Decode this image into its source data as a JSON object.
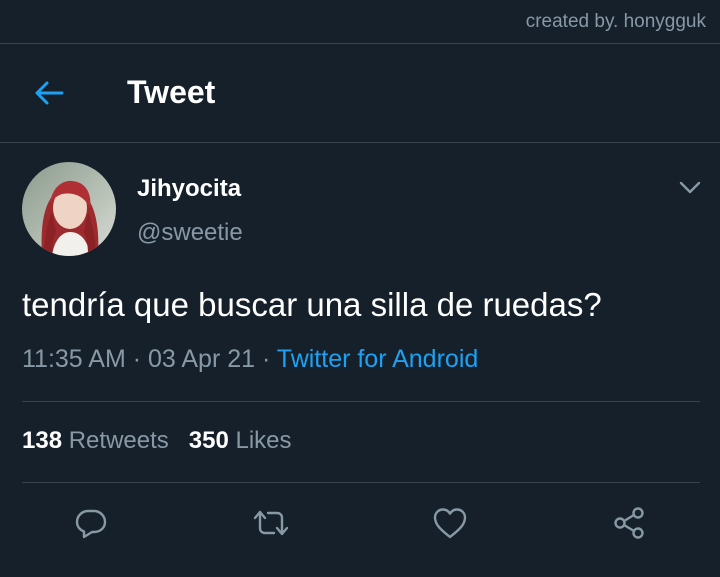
{
  "credit": "created by. honygguk",
  "header": {
    "title": "Tweet"
  },
  "tweet": {
    "author_name": "Jihyocita",
    "author_handle": "@sweetie",
    "text": "tendría que buscar una silla de ruedas?",
    "time": "11:35 AM",
    "date": "03 Apr 21",
    "source": "Twitter for Android",
    "retweet_count": "138",
    "retweet_label": "Retweets",
    "like_count": "350",
    "like_label": "Likes"
  },
  "colors": {
    "background": "#15202b",
    "divider": "#38444d",
    "secondary_text": "#8899a6",
    "accent": "#1da1f2"
  },
  "icons": {
    "back": "arrow-left-icon",
    "menu": "chevron-down-icon",
    "reply": "reply-icon",
    "retweet": "retweet-icon",
    "like": "heart-icon",
    "share": "share-icon"
  }
}
